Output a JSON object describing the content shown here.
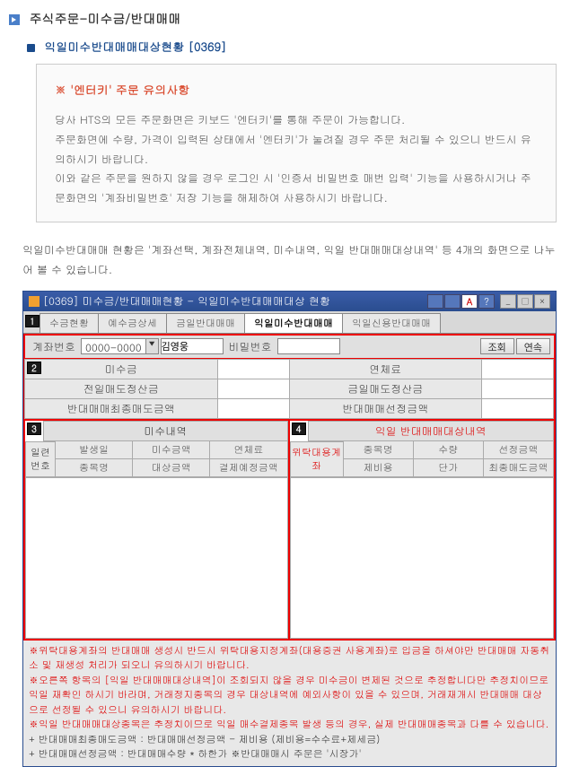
{
  "breadcrumb": "주식주문-미수금/반대매매",
  "subtitle": "익일미수반대매매대상현황 [0369]",
  "notice": {
    "title": "※ '엔터키' 주문 유의사항",
    "p1": "당사 HTS의 모든 주문화면은 키보드 '엔터키'를 통해 주문이 가능합니다.",
    "p2": "주문화면에 수량, 가격이 입력된 상태에서 '엔터키'가 눌려질 경우 주문 처리될 수 있으니 반드시 유의하시기 바랍니다.",
    "p3": "이와 같은 주문을 원하지 않을 경우 로그인 시 '인증서 비밀번호 매번 입력' 기능을 사용하시거나 주문화면의 '계좌비밀번호' 저장 기능을 해제하여 사용하시기 바랍니다."
  },
  "intro": "익일미수반대매매 현황은 '계좌선택, 계좌전체내역, 미수내역, 익일 반대매매대상내역' 등 4개의 화면으로 나누어 볼 수 있습니다.",
  "window": {
    "title": "[0369] 미수금/반대매매현황 - 익일미수반대매매대상 현황",
    "tabs": [
      "수금현황",
      "예수금상세",
      "금일반대매매",
      "익일미수반대매매",
      "익일신용반대매매"
    ],
    "active_tab": 3
  },
  "form": {
    "acct_label": "계좌번호",
    "acct_value": "0000-0000",
    "name_value": "김영웅",
    "pwd_label": "비밀번호",
    "btn_query": "조회",
    "btn_cont": "연속"
  },
  "summary_labels": {
    "misu": "미수금",
    "yeonche": "연체료",
    "jeonil": "전일매도정산금",
    "geumil": "금일매도정산금",
    "bandae_final": "반대매매최종매도금액",
    "bandae_select": "반대매매선정금액"
  },
  "left": {
    "title": "미수내역",
    "rowlabel1": "일련",
    "rowlabel2": "번호",
    "h1": "발생일",
    "h2": "미수금액",
    "h3": "연체료",
    "h4": "종목명",
    "h5": "대상금액",
    "h6": "결제예정금액"
  },
  "right": {
    "title": "익일 반대매매대상내역",
    "side_label": "위탁대용계좌",
    "h1": "종목명",
    "h2": "수량",
    "h3": "선정금액",
    "h4": "제비용",
    "h5": "단가",
    "h6": "최종매도금액"
  },
  "foot": {
    "n1": "※위탁대용계좌의 반대매매 생성시 반드시 위탁대용지정계좌(대용증권 사용계좌)로 입금을 하셔야만 반대매매 자동취소 및 재생성 처리가 되오니 유의하시기 바랍니다.",
    "n2": "※오른쪽 항목의 [익일 반대매매대상내역]이 조회되지 않을 경우 미수금이 변제된 것으로 추정합니다만 추정치이므로 익일 재확인 하시기 바라며, 거래정지종목의 경우 대상내역에 예외사항이 있을 수 있으며, 거래재개시 반대매매 대상으로 선정될 수 있으니 유의하시기 바랍니다.",
    "n3": "※익일 반대매매대상종목은 추정치이므로 익일 매수결제종목 발생 등의 경우, 실제 반대매매종목과 다를 수 있습니다.",
    "n4": "+ 반대매매최종매도금액 :  반대매매선정금액 - 제비용 (제비용=수수료+제세금)",
    "n5": "+ 반대매매선정금액 :  반대매매수량 * 하한가                      ※반대매매시 주문은 '시장가'"
  },
  "markers": {
    "m1": "1",
    "m2": "2",
    "m3": "3",
    "m4": "4"
  }
}
